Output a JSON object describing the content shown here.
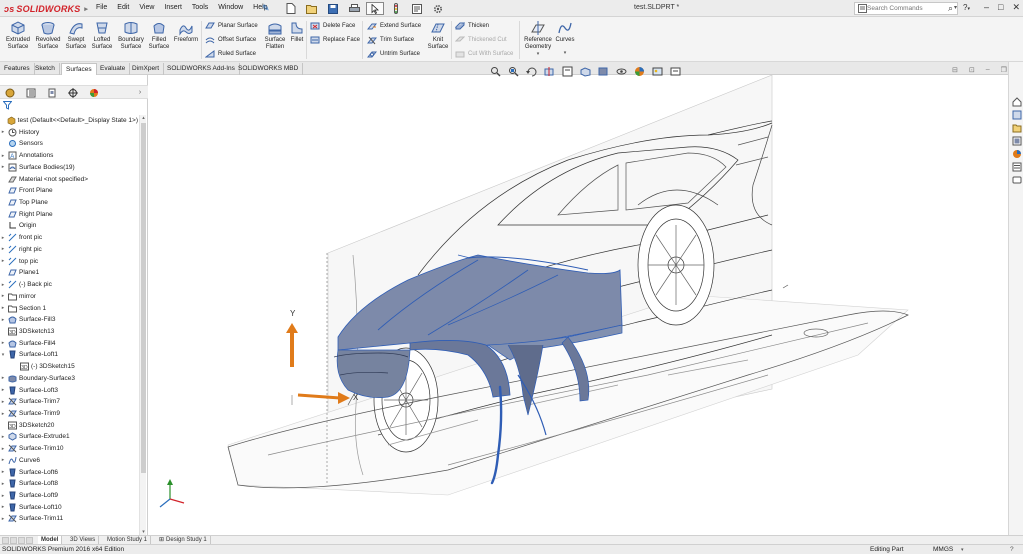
{
  "app": {
    "brand": "SOLIDWORKS",
    "document_title": "test.SLDPRT *"
  },
  "menu": [
    "File",
    "Edit",
    "View",
    "Insert",
    "Tools",
    "Window",
    "Help"
  ],
  "search": {
    "placeholder": "Search Commands"
  },
  "ribbon": {
    "big_buttons": [
      {
        "label": "Extruded\nSurface",
        "icon": "extruded-surface-icon"
      },
      {
        "label": "Revolved\nSurface",
        "icon": "revolved-surface-icon"
      },
      {
        "label": "Swept\nSurface",
        "icon": "swept-surface-icon"
      },
      {
        "label": "Lofted\nSurface",
        "icon": "lofted-surface-icon"
      },
      {
        "label": "Boundary\nSurface",
        "icon": "boundary-surface-icon"
      },
      {
        "label": "Filled\nSurface",
        "icon": "filled-surface-icon"
      },
      {
        "label": "Freeform",
        "icon": "freeform-icon"
      }
    ],
    "planar_surface": "Planar Surface",
    "offset_surface": "Offset Surface",
    "ruled_surface": "Ruled Surface",
    "surface_flatten": "Surface\nFlatten",
    "fillet": "Fillet",
    "delete_face": "Delete Face",
    "replace_face": "Replace Face",
    "extend_surface": "Extend Surface",
    "trim_surface": "Trim Surface",
    "untrim_surface": "Untrim Surface",
    "knit_surface": "Knit\nSurface",
    "thicken": "Thicken",
    "thickened_cut": "Thickened Cut",
    "cut_with_surface": "Cut With Surface",
    "reference_geometry": "Reference\nGeometry",
    "curves": "Curves"
  },
  "command_tabs": [
    "Features",
    "Sketch",
    "Surfaces",
    "Evaluate",
    "DimXpert",
    "SOLIDWORKS Add-Ins",
    "SOLIDWORKS MBD"
  ],
  "active_command_tab": "Surfaces",
  "tree": [
    {
      "label": "test  (Default<<Default>_Display State 1>)",
      "icon": "part-icon",
      "expander": ""
    },
    {
      "label": "History",
      "icon": "history-icon",
      "expander": "▸"
    },
    {
      "label": "Sensors",
      "icon": "sensors-icon",
      "expander": ""
    },
    {
      "label": "Annotations",
      "icon": "annotations-icon",
      "expander": "▸"
    },
    {
      "label": "Surface Bodies(19)",
      "icon": "surface-bodies-icon",
      "expander": "▸"
    },
    {
      "label": "Material <not specified>",
      "icon": "material-icon",
      "expander": ""
    },
    {
      "label": "Front Plane",
      "icon": "plane-icon",
      "expander": ""
    },
    {
      "label": "Top Plane",
      "icon": "plane-icon",
      "expander": ""
    },
    {
      "label": "Right Plane",
      "icon": "plane-icon",
      "expander": ""
    },
    {
      "label": "Origin",
      "icon": "origin-icon",
      "expander": ""
    },
    {
      "label": "front pic",
      "icon": "sketch-icon",
      "expander": "▸"
    },
    {
      "label": "right pic",
      "icon": "sketch-icon",
      "expander": "▸"
    },
    {
      "label": "top pic",
      "icon": "sketch-icon",
      "expander": "▸"
    },
    {
      "label": "Plane1",
      "icon": "plane-icon",
      "expander": ""
    },
    {
      "label": "(-) Back pic",
      "icon": "sketch-icon",
      "expander": "▸"
    },
    {
      "label": "mirror",
      "icon": "folder-icon",
      "expander": "▸"
    },
    {
      "label": "Section 1",
      "icon": "folder-icon",
      "expander": "▸"
    },
    {
      "label": "Surface-Fill3",
      "icon": "surface-fill-icon",
      "expander": "▸"
    },
    {
      "label": "3DSketch13",
      "icon": "3dsketch-icon",
      "expander": ""
    },
    {
      "label": "Surface-Fill4",
      "icon": "surface-fill-icon",
      "expander": "▸"
    },
    {
      "label": "Surface-Loft1",
      "icon": "surface-loft-icon",
      "expander": "▾"
    },
    {
      "label": "(-) 3DSketch15",
      "icon": "3dsketch-icon",
      "expander": "",
      "indent": 1
    },
    {
      "label": "Boundary-Surface3",
      "icon": "boundary-surface-icon",
      "expander": "▸"
    },
    {
      "label": "Surface-Loft3",
      "icon": "surface-loft-icon",
      "expander": "▸"
    },
    {
      "label": "Surface-Trim7",
      "icon": "surface-trim-icon",
      "expander": "▸"
    },
    {
      "label": "Surface-Trim9",
      "icon": "surface-trim-icon",
      "expander": "▸"
    },
    {
      "label": "3DSketch20",
      "icon": "3dsketch-icon",
      "expander": ""
    },
    {
      "label": "Surface-Extrude1",
      "icon": "surface-extrude-icon",
      "expander": "▸"
    },
    {
      "label": "Surface-Trim10",
      "icon": "surface-trim-icon",
      "expander": "▸"
    },
    {
      "label": "Curve6",
      "icon": "curve-icon",
      "expander": "▸"
    },
    {
      "label": "Surface-Loft6",
      "icon": "surface-loft-icon",
      "expander": "▸"
    },
    {
      "label": "Surface-Loft8",
      "icon": "surface-loft-icon",
      "expander": "▸"
    },
    {
      "label": "Surface-Loft9",
      "icon": "surface-loft-icon",
      "expander": "▸"
    },
    {
      "label": "Surface-Loft10",
      "icon": "surface-loft-icon",
      "expander": "▸"
    },
    {
      "label": "Surface-Trim11",
      "icon": "surface-trim-icon",
      "expander": "▸"
    }
  ],
  "triad": {
    "x": "X",
    "y": "Y"
  },
  "bottom_tabs": [
    "Model",
    "3D Views",
    "Motion Study 1",
    "Design Study 1"
  ],
  "active_bottom_tab": "Model",
  "status": {
    "edition": "SOLIDWORKS Premium 2016 x64 Edition",
    "mode": "Editing Part",
    "units": "MMGS",
    "units_caret": "▾"
  },
  "colors": {
    "brand_red": "#d2232a",
    "surface_fill": "#7d8aaa",
    "surface_edge": "#2f5db5",
    "triad_y": "#e07b1a",
    "triad_x": "#e07b1a",
    "ribbon_bg": "#f4f4f4"
  }
}
